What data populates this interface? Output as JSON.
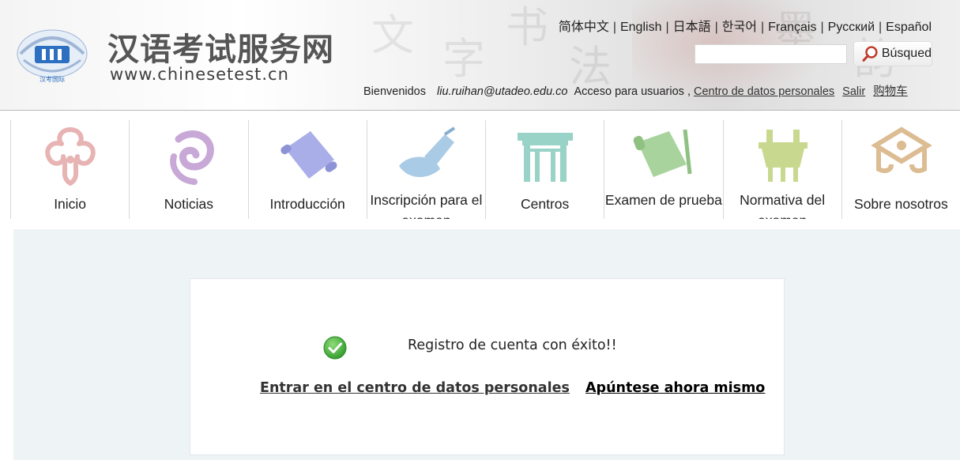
{
  "header": {
    "logo_title": "汉语考试服务网",
    "logo_url": "www.chinesetest.cn",
    "logo_badge": "汉考国际",
    "languages": [
      "简体中文",
      "English",
      "日本語",
      "한국어",
      "Français",
      "Русский",
      "Español"
    ],
    "search": {
      "value": "",
      "placeholder": "",
      "button_label": "Búsqued"
    },
    "user": {
      "welcome": "Bienvenidos",
      "email": "liu.ruihan@utadeo.edu.co",
      "access_text": "Acceso para usuarios ,",
      "personal_center_link": "Centro de datos personales",
      "logout_link": "Salir",
      "cart_link": "购物车"
    }
  },
  "nav": {
    "items": [
      {
        "label": "Inicio",
        "icon": "ruyi-cloud-icon",
        "color": "#e7b3b3"
      },
      {
        "label": "Noticias",
        "icon": "swirl-cloud-icon",
        "color": "#c8a8d6"
      },
      {
        "label": "Introducción",
        "icon": "scroll-icon",
        "color": "#a9aee8"
      },
      {
        "label": "Inscripción para el examen",
        "icon": "brush-scroll-icon",
        "color": "#a9cbe6"
      },
      {
        "label": "Centros",
        "icon": "archway-icon",
        "color": "#99d2c6"
      },
      {
        "label": "Examen de prueba",
        "icon": "open-scroll-icon",
        "color": "#a8d39c"
      },
      {
        "label": "Normativa del examen",
        "icon": "ding-vessel-icon",
        "color": "#c8d88e"
      },
      {
        "label": "Sobre nosotros",
        "icon": "seal-box-icon",
        "color": "#dcbc92"
      }
    ]
  },
  "main": {
    "success_message": "Registro de cuenta con éxito!!",
    "link_personal_center": "Entrar en el centro de datos personales",
    "link_enroll_now": "Apúntese ahora mismo",
    "success_icon": "check-circle-icon",
    "success_color": "#4caf3e"
  }
}
